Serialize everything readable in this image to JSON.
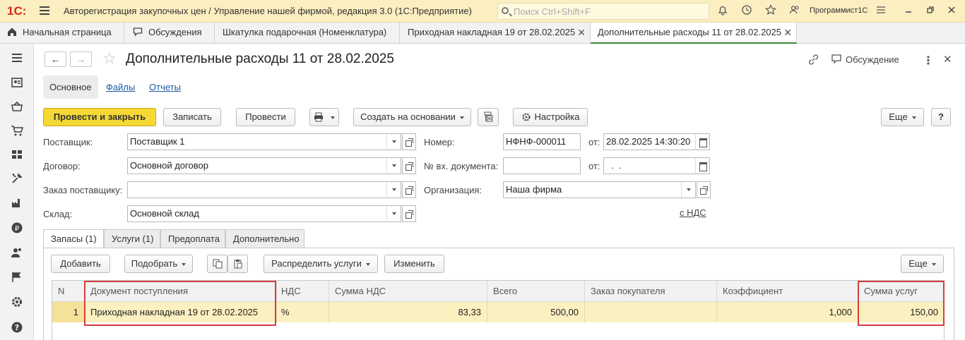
{
  "app": {
    "logo": "1С:",
    "title": "Авторегистрация закупочных цен / Управление нашей фирмой, редакция 3.0  (1С:Предприятие)",
    "search_placeholder": "Поиск Ctrl+Shift+F",
    "user": "Программист1С"
  },
  "open_tabs": [
    {
      "label": "Начальная страница"
    },
    {
      "label": "Обсуждения"
    },
    {
      "label": "Шкатулка подарочная (Номенклатура)"
    },
    {
      "label": "Приходная накладная 19 от 28.02.2025"
    },
    {
      "label": "Дополнительные расходы 11 от 28.02.2025"
    }
  ],
  "document": {
    "title": "Дополнительные расходы 11 от 28.02.2025",
    "discussion_label": "Обсуждение",
    "subtabs": {
      "main": "Основное",
      "files": "Файлы",
      "reports": "Отчеты"
    }
  },
  "toolbar": {
    "post_close": "Провести и закрыть",
    "save": "Записать",
    "post": "Провести",
    "create_based": "Создать на основании",
    "settings": "Настройка",
    "more": "Еще",
    "help": "?"
  },
  "form": {
    "supplier_label": "Поставщик:",
    "supplier_value": "Поставщик 1",
    "contract_label": "Договор:",
    "contract_value": "Основной договор",
    "order_label": "Заказ поставщику:",
    "order_value": "",
    "warehouse_label": "Склад:",
    "warehouse_value": "Основной склад",
    "number_label": "Номер:",
    "number_value": "НФНФ-000011",
    "date_label": "от:",
    "date_value": "28.02.2025 14:30:20",
    "incoming_label": "№ вх. документа:",
    "incoming_value": "",
    "incoming_date_label": "от:",
    "incoming_date_value": "  .  .",
    "org_label": "Организация:",
    "org_value": "Наша фирма",
    "vat_link": "с НДС"
  },
  "inner_tabs": [
    {
      "label": "Запасы (1)"
    },
    {
      "label": "Услуги (1)"
    },
    {
      "label": "Предоплата"
    },
    {
      "label": "Дополнительно"
    }
  ],
  "table_toolbar": {
    "add": "Добавить",
    "pick": "Подобрать",
    "distribute": "Распределить услуги",
    "change": "Изменить",
    "more": "Еще"
  },
  "table": {
    "columns": [
      "N",
      "Документ поступления",
      "НДС",
      "Сумма НДС",
      "Всего",
      "Заказ покупателя",
      "Коэффициент",
      "Сумма услуг"
    ],
    "rows": [
      [
        "1",
        "Приходная накладная 19 от 28.02.2025",
        "%",
        "83,33",
        "500,00",
        "",
        "1,000",
        "150,00"
      ]
    ]
  },
  "colors": {
    "accent": "#f5d834",
    "highlight": "#d24040",
    "titlebar": "#fbeec0"
  }
}
